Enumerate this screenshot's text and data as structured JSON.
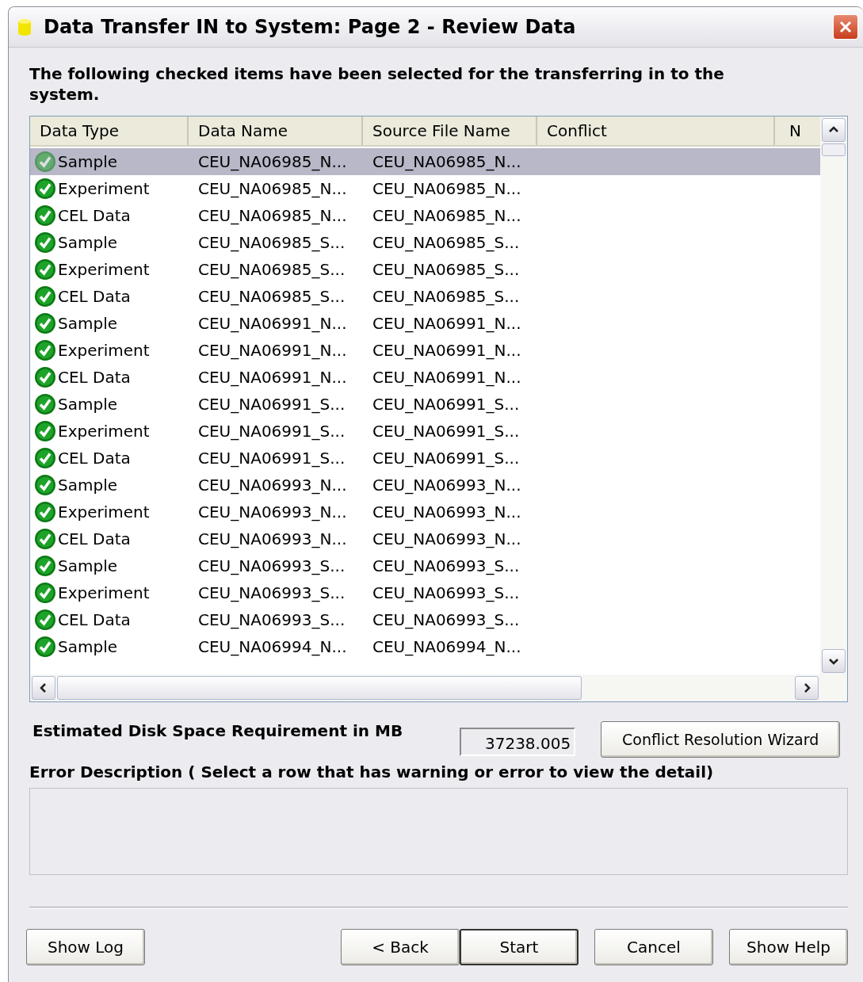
{
  "window": {
    "title": "Data Transfer IN to System: Page 2 - Review Data"
  },
  "intro": "The following checked items have been selected for the transferring in to the system.",
  "table": {
    "columns": [
      "Data Type",
      "Data Name",
      "Source File Name",
      "Conflict",
      "N"
    ],
    "rows": [
      {
        "type": "Sample",
        "name": "CEU_NA06985_N...",
        "source": "CEU_NA06985_N...",
        "checked": true,
        "selected": true
      },
      {
        "type": "Experiment",
        "name": "CEU_NA06985_N...",
        "source": "CEU_NA06985_N...",
        "checked": true,
        "selected": false
      },
      {
        "type": "CEL Data",
        "name": "CEU_NA06985_N...",
        "source": "CEU_NA06985_N...",
        "checked": true,
        "selected": false
      },
      {
        "type": "Sample",
        "name": "CEU_NA06985_S...",
        "source": "CEU_NA06985_S...",
        "checked": true,
        "selected": false
      },
      {
        "type": "Experiment",
        "name": "CEU_NA06985_S...",
        "source": "CEU_NA06985_S...",
        "checked": true,
        "selected": false
      },
      {
        "type": "CEL Data",
        "name": "CEU_NA06985_S...",
        "source": "CEU_NA06985_S...",
        "checked": true,
        "selected": false
      },
      {
        "type": "Sample",
        "name": "CEU_NA06991_N...",
        "source": "CEU_NA06991_N...",
        "checked": true,
        "selected": false
      },
      {
        "type": "Experiment",
        "name": "CEU_NA06991_N...",
        "source": "CEU_NA06991_N...",
        "checked": true,
        "selected": false
      },
      {
        "type": "CEL Data",
        "name": "CEU_NA06991_N...",
        "source": "CEU_NA06991_N...",
        "checked": true,
        "selected": false
      },
      {
        "type": "Sample",
        "name": "CEU_NA06991_S...",
        "source": "CEU_NA06991_S...",
        "checked": true,
        "selected": false
      },
      {
        "type": "Experiment",
        "name": "CEU_NA06991_S...",
        "source": "CEU_NA06991_S...",
        "checked": true,
        "selected": false
      },
      {
        "type": "CEL Data",
        "name": "CEU_NA06991_S...",
        "source": "CEU_NA06991_S...",
        "checked": true,
        "selected": false
      },
      {
        "type": "Sample",
        "name": "CEU_NA06993_N...",
        "source": "CEU_NA06993_N...",
        "checked": true,
        "selected": false
      },
      {
        "type": "Experiment",
        "name": "CEU_NA06993_N...",
        "source": "CEU_NA06993_N...",
        "checked": true,
        "selected": false
      },
      {
        "type": "CEL Data",
        "name": "CEU_NA06993_N...",
        "source": "CEU_NA06993_N...",
        "checked": true,
        "selected": false
      },
      {
        "type": "Sample",
        "name": "CEU_NA06993_S...",
        "source": "CEU_NA06993_S...",
        "checked": true,
        "selected": false
      },
      {
        "type": "Experiment",
        "name": "CEU_NA06993_S...",
        "source": "CEU_NA06993_S...",
        "checked": true,
        "selected": false
      },
      {
        "type": "CEL Data",
        "name": "CEU_NA06993_S...",
        "source": "CEU_NA06993_S...",
        "checked": true,
        "selected": false
      },
      {
        "type": "Sample",
        "name": "CEU_NA06994_N...",
        "source": "CEU_NA06994_N...",
        "checked": true,
        "selected": false
      }
    ]
  },
  "disk_space": {
    "label": "Estimated Disk Space Requirement in MB",
    "value": "37238.005"
  },
  "conflict_button": "Conflict Resolution Wizard",
  "error": {
    "label": "Error Description ( Select a row that has warning or error to view the detail)"
  },
  "buttons": {
    "show_log": "Show Log",
    "back": "< Back",
    "start": "Start",
    "cancel": "Cancel",
    "show_help": "Show Help"
  }
}
